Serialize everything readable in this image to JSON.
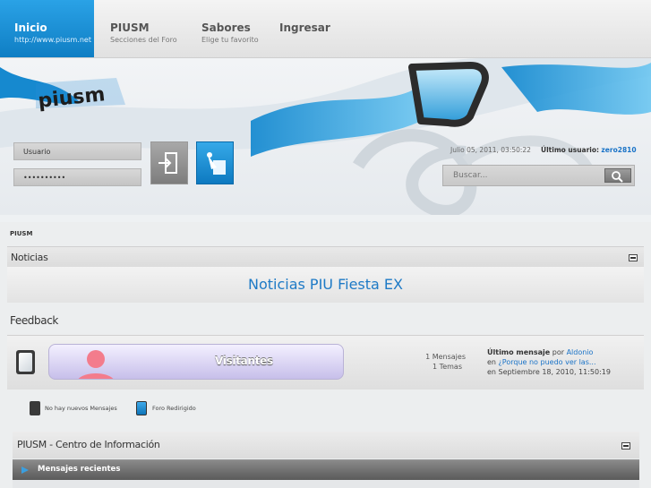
{
  "nav": {
    "items": [
      {
        "title": "Inicio",
        "subtitle": "http://www.piusm.net"
      },
      {
        "title": "PIUSM",
        "subtitle": "Secciones del Foro"
      },
      {
        "title": "Sabores",
        "subtitle": "Elige tu favorito"
      },
      {
        "title": "Ingresar",
        "subtitle": ""
      }
    ]
  },
  "login": {
    "username_value": "Usuario",
    "password_value": "••••••••••"
  },
  "header": {
    "datetime": "Julio 05, 2011, 03:50:22",
    "last_user_label": "Último usuario:",
    "last_user": "zero2810",
    "search_placeholder": "Buscar..."
  },
  "breadcrumb": "PIUSM",
  "categories": {
    "news": {
      "title": "Noticias",
      "headline": "Noticias PIU Fiesta EX"
    },
    "feedback": {
      "title": "Feedback",
      "board": {
        "name": "Visitantes",
        "messages": "1 Mensajes",
        "topics": "1 Temas",
        "last_post_label": "Último mensaje",
        "by": "por",
        "author": "Aldonio",
        "in": "en",
        "topic": "¿Porque no puedo ver las...",
        "date": "en Septiembre 18, 2010, 11:50:19"
      }
    },
    "info": {
      "title": "PIUSM - Centro de Información",
      "recent_label": "Mensajes recientes"
    }
  },
  "legend": {
    "no_new": "No hay nuevos Mensajes",
    "redirect": "Foro Redirigido"
  },
  "colors": {
    "accent": "#1e7ac6",
    "nav_active": "#0f7ec4"
  }
}
